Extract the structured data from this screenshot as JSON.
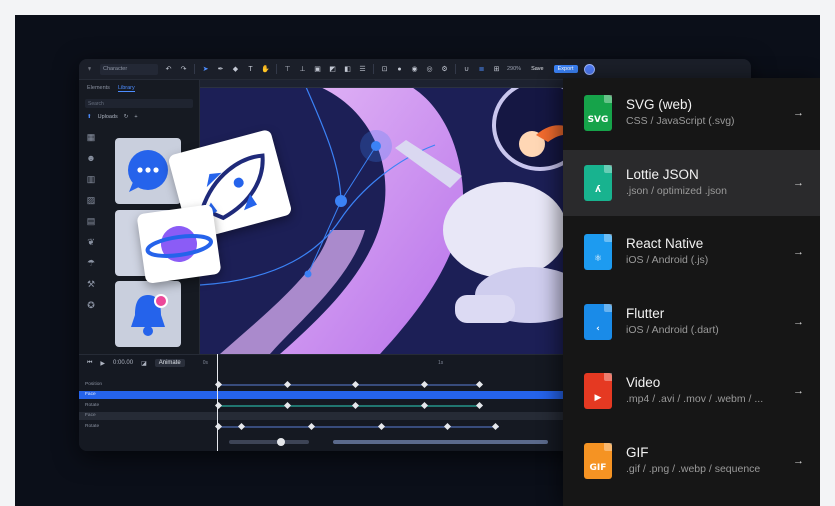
{
  "toolbar": {
    "name_field": "Character",
    "zoom": "290%",
    "save_label": "Save",
    "export_label": "Export"
  },
  "left_panel": {
    "tabs": [
      "Elements",
      "Library"
    ],
    "active_tab": "Library",
    "search_placeholder": "Search",
    "uploads_label": "Uploads"
  },
  "timeline": {
    "time": "0:00.00",
    "animate_label": "Animate",
    "ruler_marks": [
      "0s",
      "1s"
    ],
    "rows": [
      {
        "label": "Position",
        "style": "plain"
      },
      {
        "label": "Face",
        "style": "blue"
      },
      {
        "label": "Rotate",
        "style": "plain"
      },
      {
        "label": "Face",
        "style": "gray"
      },
      {
        "label": "Rotate",
        "style": "plain"
      }
    ]
  },
  "export_menu": {
    "items": [
      {
        "title": "SVG (web)",
        "subtitle": "CSS / JavaScript (.svg)",
        "icon": "svg-file-icon",
        "glyph": "SVG",
        "color": "#16a34a",
        "active": false
      },
      {
        "title": "Lottie JSON",
        "subtitle": ".json / optimized .json",
        "icon": "lottie-file-icon",
        "glyph": "ʎ",
        "color": "#18b38f",
        "active": true
      },
      {
        "title": "React Native",
        "subtitle": "iOS / Android (.js)",
        "icon": "react-file-icon",
        "glyph": "⚛",
        "color": "#1d9bf0",
        "active": false
      },
      {
        "title": "Flutter",
        "subtitle": "iOS / Android (.dart)",
        "icon": "flutter-file-icon",
        "glyph": "‹",
        "color": "#1a8be8",
        "active": false
      },
      {
        "title": "Video",
        "subtitle": ".mp4 / .avi / .mov / .webm / ...",
        "icon": "video-file-icon",
        "glyph": "▶",
        "color": "#e53922",
        "active": false
      },
      {
        "title": "GIF",
        "subtitle": ".gif / .png / .webp / sequence",
        "icon": "gif-file-icon",
        "glyph": "GIF",
        "color": "#f59323",
        "active": false
      }
    ]
  },
  "colors": {
    "accent": "#3b82f6",
    "canvas_bg": "#1c1f56",
    "menu_bg": "#161616"
  }
}
